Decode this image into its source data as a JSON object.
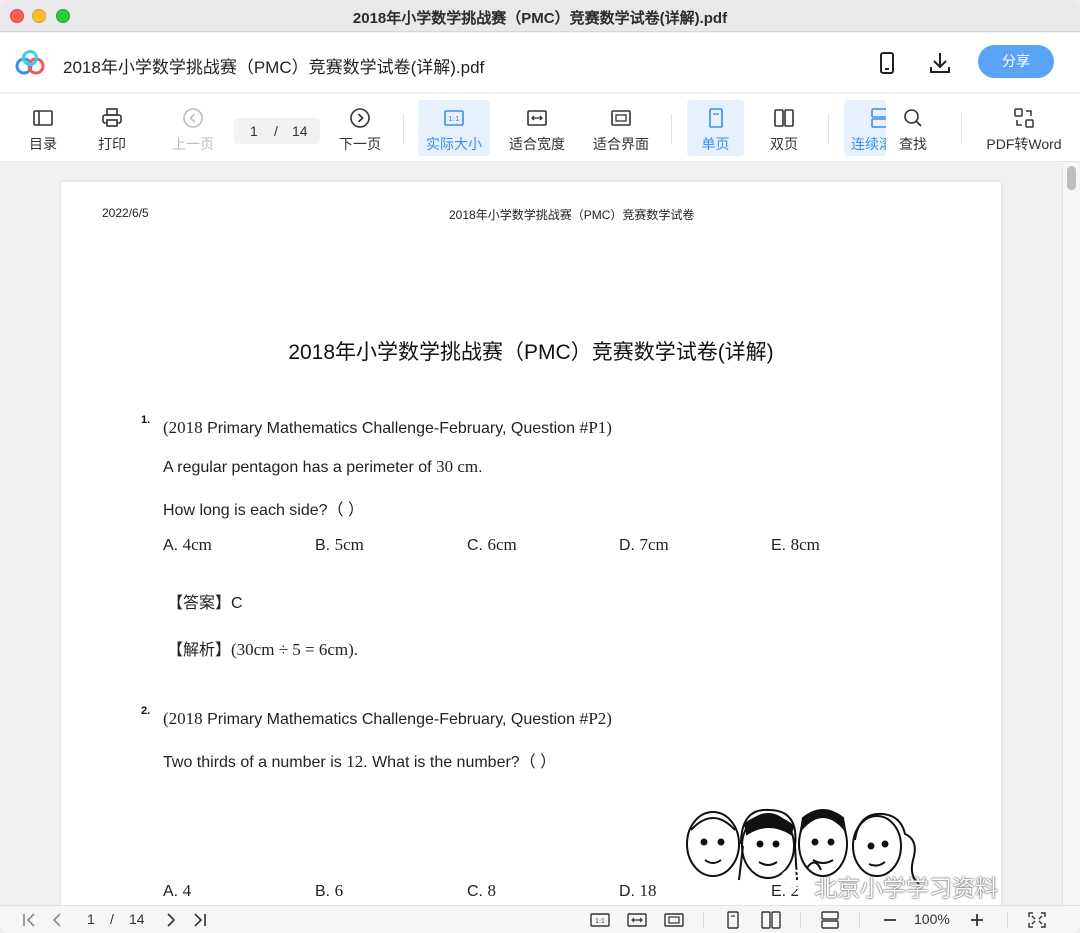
{
  "window": {
    "title": "2018年小学数学挑战赛（PMC）竞赛数学试卷(详解).pdf"
  },
  "header": {
    "doc_title": "2018年小学数学挑战赛（PMC）竞赛数学试卷(详解).pdf",
    "share_label": "分享",
    "brand_colors": {
      "accent": "#3a8ef0",
      "share_bg": "#5aa4f7"
    }
  },
  "toolbar": {
    "toc": "目录",
    "print": "打印",
    "prev": "上一页",
    "page_current": "1",
    "page_sep": "/",
    "page_total": "14",
    "next": "下一页",
    "actual_size": "实际大小",
    "fit_width": "适合宽度",
    "fit_page": "适合界面",
    "single": "单页",
    "double": "双页",
    "continuous": "连续滚",
    "find": "查找",
    "pdf2word": "PDF转Word"
  },
  "page": {
    "date": "2022/6/5",
    "header": "2018年小学数学挑战赛（PMC）竞赛数学试卷",
    "title": "2018年小学数学挑战赛（PMC）竞赛数学试卷(详解)",
    "q1": {
      "num": "1.",
      "source_a": "(2018",
      "source_b": " Primary Mathematics Challenge-February, Question #",
      "source_c": "P1)",
      "line1_a": "A regular pentagon has a perimeter of ",
      "line1_math": "30 cm",
      "line1_b": ".",
      "line2": "How long is each side?（   ）",
      "options": [
        {
          "label": "A. ",
          "value": "4cm"
        },
        {
          "label": "B. ",
          "value": "5cm"
        },
        {
          "label": "C. ",
          "value": "6cm"
        },
        {
          "label": "D. ",
          "value": "7cm"
        },
        {
          "label": "E. ",
          "value": "8cm"
        }
      ],
      "answer_label": "【答案】",
      "answer": "C",
      "analysis_label": "【解析】",
      "analysis": "(30cm ÷ 5 = 6cm)."
    },
    "q2": {
      "num": "2.",
      "source_a": "(2018",
      "source_b": " Primary Mathematics Challenge-February, Question #",
      "source_c": "P2)",
      "line1_a": "Two thirds of a number is ",
      "line1_math": "12",
      "line1_b": ". What is the number?（   ）",
      "options": [
        {
          "label": "A. ",
          "value": "4"
        },
        {
          "label": "B. ",
          "value": "6"
        },
        {
          "label": "C. ",
          "value": "8"
        },
        {
          "label": "D. ",
          "value": "18"
        },
        {
          "label": "E. ",
          "value": "2"
        }
      ]
    },
    "watermark": "北京小学学习资料"
  },
  "status": {
    "page_current": "1",
    "page_sep": "/",
    "page_total": "14",
    "zoom": "100%"
  }
}
